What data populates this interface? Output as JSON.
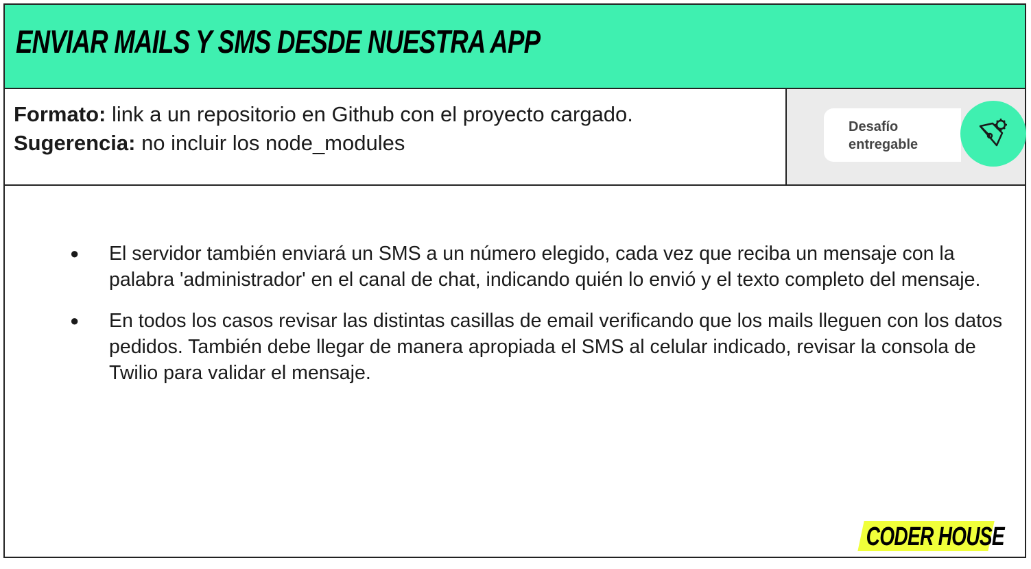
{
  "header": {
    "title": "ENVIAR MAILS Y SMS DESDE NUESTRA APP"
  },
  "info": {
    "format_label": "Formato:",
    "format_text": " link a un repositorio en Github con el proyecto cargado.",
    "suggestion_label": "Sugerencia:",
    "suggestion_text": " no incluir los node_modules"
  },
  "badge": {
    "line1": "Desafío",
    "line2": "entregable",
    "icon": "pen-gear-icon"
  },
  "content": {
    "bullets": [
      "El servidor también enviará un SMS a un número elegido, cada vez que reciba un mensaje con la palabra 'administrador' en el canal de chat, indicando quién lo envió y el texto completo del mensaje.",
      "En todos los casos revisar las distintas casillas de email verificando que los mails lleguen con los datos pedidos. También debe llegar de manera apropiada el SMS al celular indicado, revisar la consola de Twilio para validar el mensaje."
    ],
    "bullet_symbol": "●"
  },
  "logo": {
    "text": "CODER HOUSE"
  },
  "colors": {
    "accent": "#3ff0b0",
    "logo_bg": "#f0ff3a"
  }
}
